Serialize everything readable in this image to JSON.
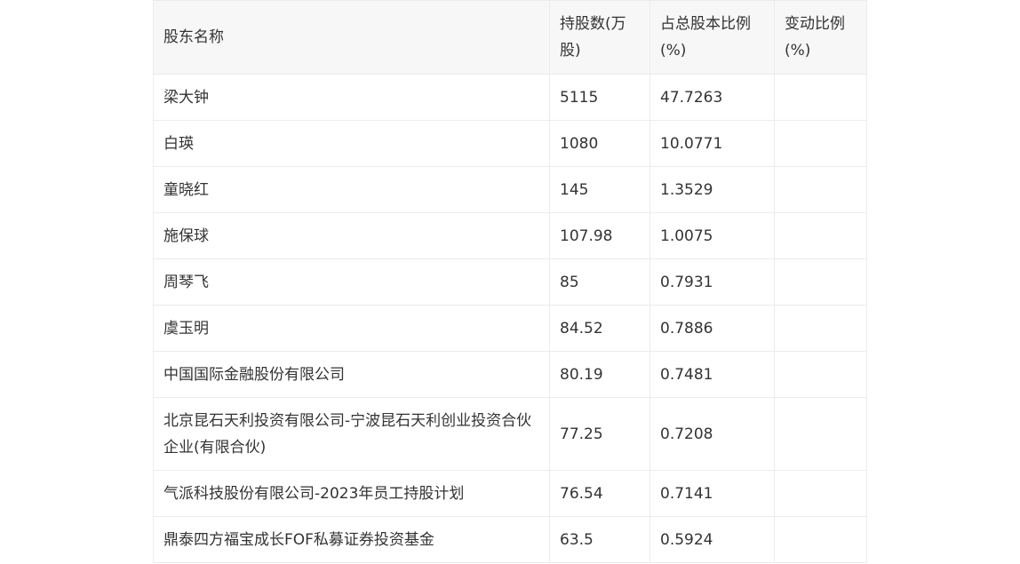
{
  "table": {
    "headers": [
      "股东名称",
      "持股数(万股)",
      "占总股本比例(%)",
      "变动比例(%)"
    ],
    "rows": [
      {
        "name": "梁大钟",
        "shares": "5115",
        "ratio": "47.7263",
        "change": ""
      },
      {
        "name": "白瑛",
        "shares": "1080",
        "ratio": "10.0771",
        "change": ""
      },
      {
        "name": "童晓红",
        "shares": "145",
        "ratio": "1.3529",
        "change": ""
      },
      {
        "name": "施保球",
        "shares": "107.98",
        "ratio": "1.0075",
        "change": ""
      },
      {
        "name": "周琴飞",
        "shares": "85",
        "ratio": "0.7931",
        "change": ""
      },
      {
        "name": "虞玉明",
        "shares": "84.52",
        "ratio": "0.7886",
        "change": ""
      },
      {
        "name": "中国国际金融股份有限公司",
        "shares": "80.19",
        "ratio": "0.7481",
        "change": ""
      },
      {
        "name": "北京昆石天利投资有限公司-宁波昆石天利创业投资合伙企业(有限合伙)",
        "shares": "77.25",
        "ratio": "0.7208",
        "change": ""
      },
      {
        "name": "气派科技股份有限公司-2023年员工持股计划",
        "shares": "76.54",
        "ratio": "0.7141",
        "change": ""
      },
      {
        "name": "鼎泰四方福宝成长FOF私募证券投资基金",
        "shares": "63.5",
        "ratio": "0.5924",
        "change": ""
      }
    ]
  }
}
